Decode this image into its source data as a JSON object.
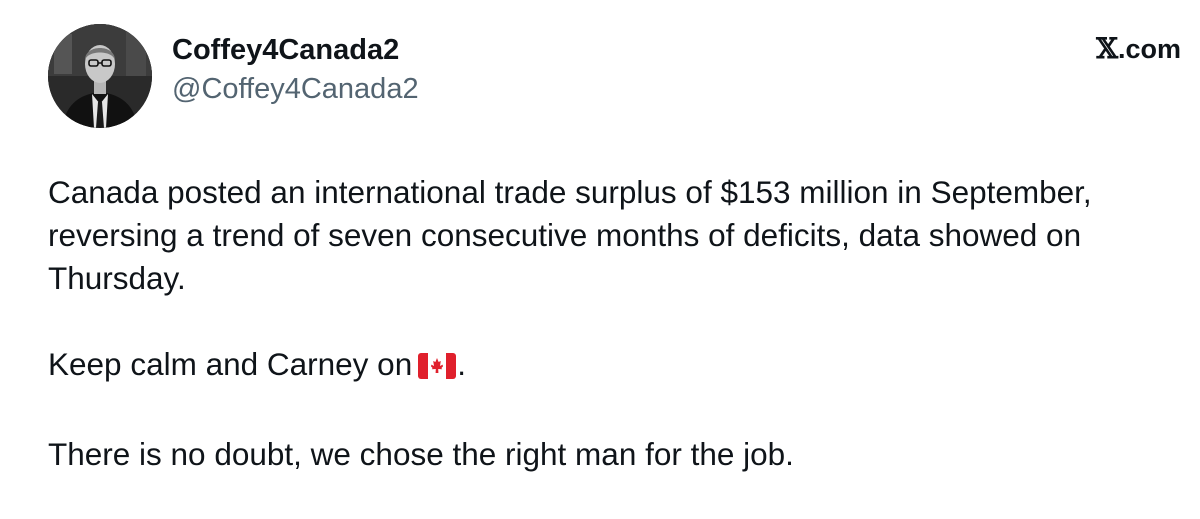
{
  "author": {
    "display_name": "Coffey4Canada2",
    "handle": "@Coffey4Canada2"
  },
  "site": {
    "glyph": "𝕏",
    "label": ".com"
  },
  "tweet": {
    "paragraph_1": "Canada posted an international trade surplus of $153 million in September, reversing a trend of seven consecutive months of deficits, data showed on Thursday.",
    "paragraph_2_text": "Keep calm and Carney on",
    "paragraph_2_end": ".",
    "paragraph_3": "There is no doubt, we chose the right man for the job."
  },
  "icons": {
    "avatar": "profile-photo",
    "flag": "canada-flag-emoji"
  },
  "colors": {
    "text": "#0f1419",
    "secondary": "#536471",
    "flag_red": "#e0202c"
  }
}
